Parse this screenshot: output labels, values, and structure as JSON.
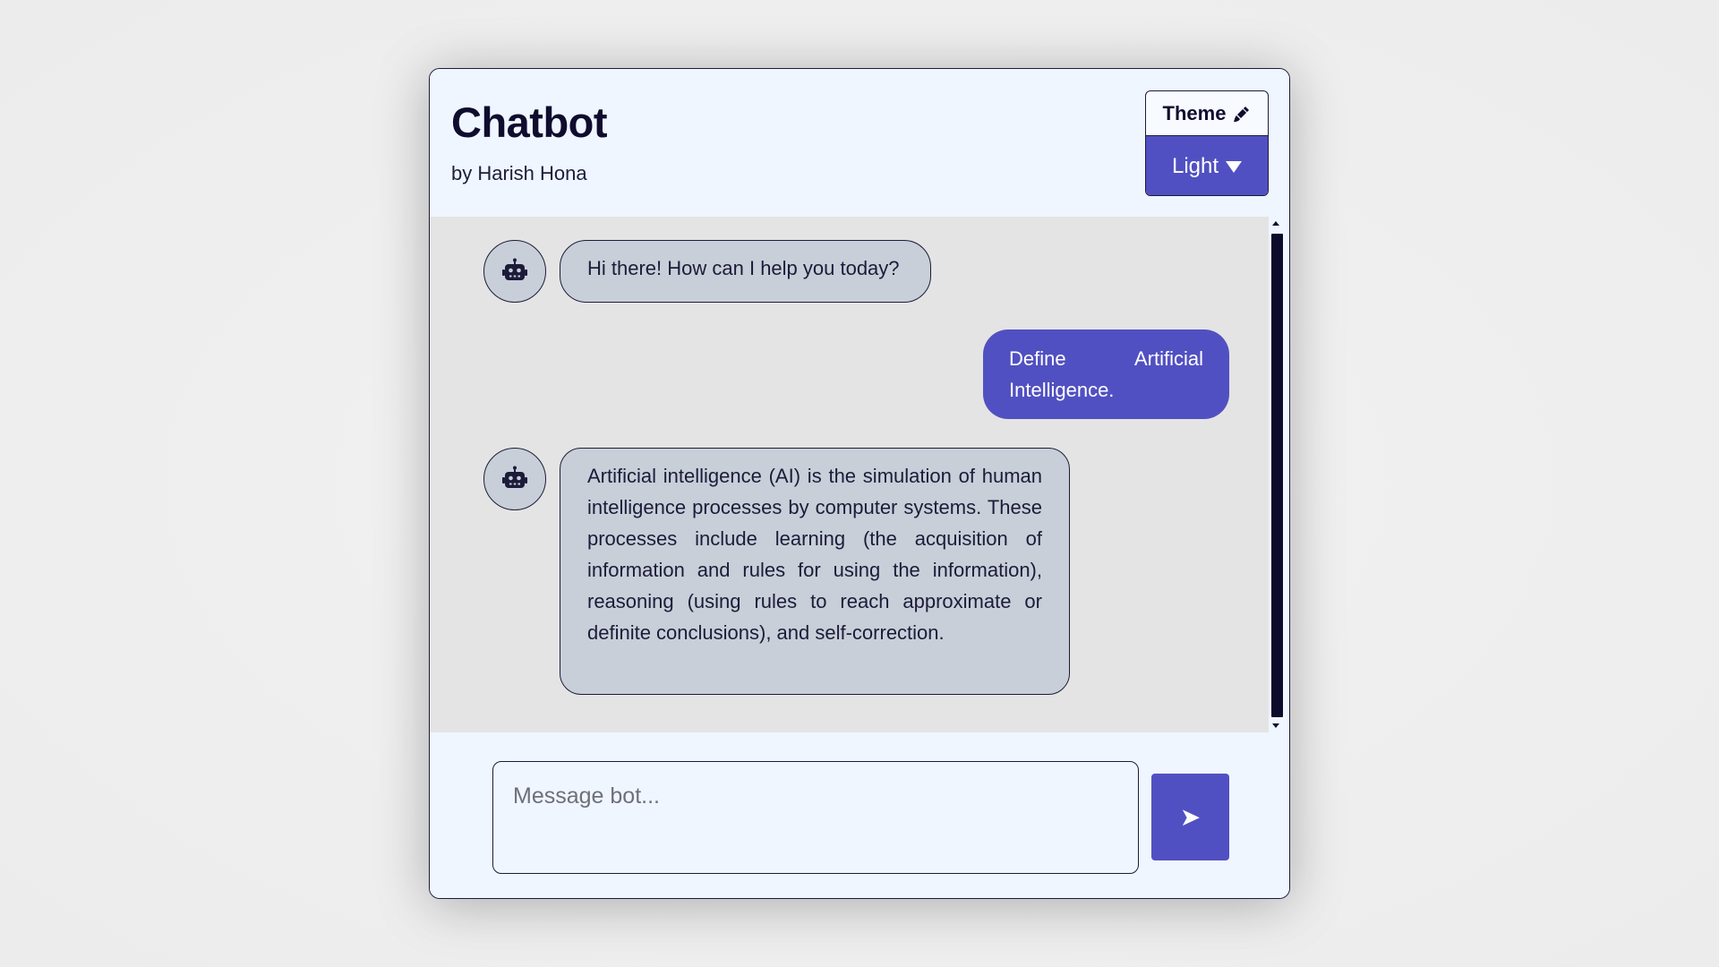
{
  "header": {
    "title": "Chatbot",
    "subtitle": "by Harish Hona"
  },
  "theme": {
    "label": "Theme",
    "selected": "Light",
    "icon": "paint-brush-icon"
  },
  "messages": [
    {
      "role": "bot",
      "text": "Hi there! How can I help you today?"
    },
    {
      "role": "user",
      "text": "Define Artificial Intelligence."
    },
    {
      "role": "bot",
      "text": "Artificial intelligence (AI) is the simulation of human intelligence processes by computer systems. These processes include learning (the acquisition of information and rules for using the information), reasoning (using rules to reach approximate or definite conclusions), and self-correction."
    }
  ],
  "composer": {
    "placeholder": "Message bot...",
    "send_label": "➤"
  },
  "colors": {
    "accent": "#5150c2",
    "background": "#eff6ff",
    "chat_background": "#e4e4e4",
    "bot_bubble": "#c8cfd8",
    "text_dark": "#0f0c2e"
  }
}
